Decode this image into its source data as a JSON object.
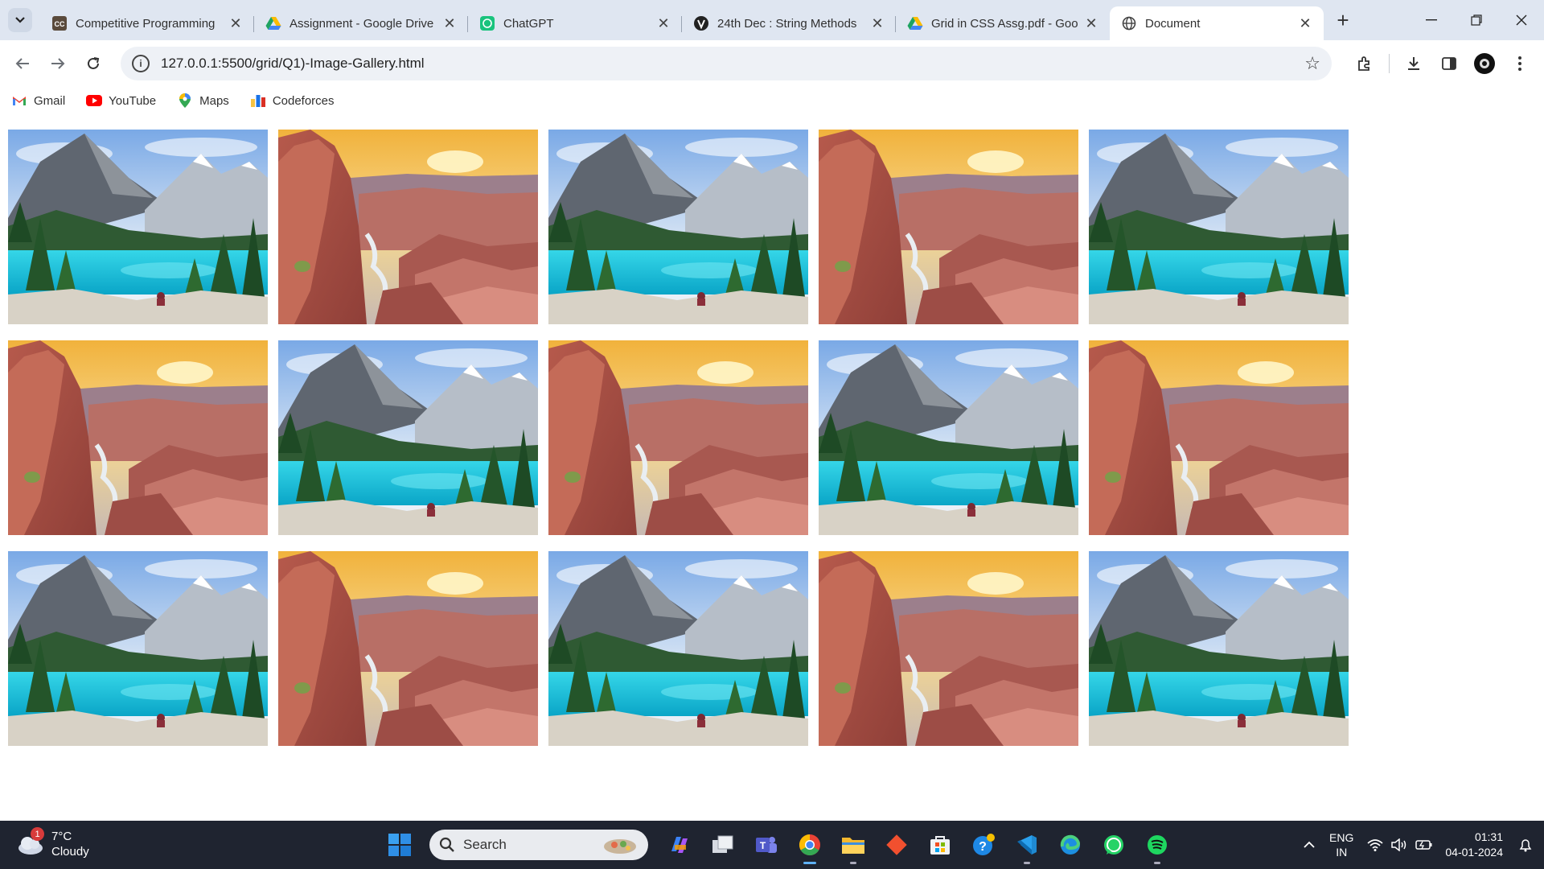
{
  "browser": {
    "tabs": [
      {
        "title": "Competitive Programming",
        "icon": "cc-icon"
      },
      {
        "title": "Assignment - Google Drive",
        "icon": "google-drive-icon"
      },
      {
        "title": "ChatGPT",
        "icon": "chatgpt-icon"
      },
      {
        "title": "24th Dec : String Methods",
        "icon": "site-icon"
      },
      {
        "title": "Grid in CSS Assg.pdf - Goo",
        "icon": "google-drive-icon"
      },
      {
        "title": "Document",
        "icon": "globe-icon",
        "active": true
      }
    ],
    "new_tab_symbol": "+",
    "address": "127.0.0.1:5500/grid/Q1)-Image-Gallery.html",
    "bookmarks": [
      {
        "label": "Gmail",
        "icon": "gmail-icon"
      },
      {
        "label": "YouTube",
        "icon": "youtube-icon"
      },
      {
        "label": "Maps",
        "icon": "maps-icon"
      },
      {
        "label": "Codeforces",
        "icon": "codeforces-icon"
      }
    ]
  },
  "gallery": {
    "rows": 3,
    "columns": 5,
    "images": [
      "lake",
      "canyon",
      "lake",
      "canyon",
      "lake",
      "canyon",
      "lake",
      "canyon",
      "lake",
      "canyon",
      "lake",
      "canyon",
      "lake",
      "canyon",
      "lake"
    ]
  },
  "taskbar": {
    "weather": {
      "temp": "7°C",
      "condition": "Cloudy",
      "badge": "1"
    },
    "search_label": "Search",
    "apps": [
      "copilot-icon",
      "task-view-icon",
      "teams-icon",
      "chrome-icon",
      "file-explorer-icon",
      "git-icon",
      "store-icon",
      "help-icon",
      "vscode-icon",
      "edge-icon",
      "whatsapp-icon",
      "spotify-icon"
    ],
    "lang": {
      "line1": "ENG",
      "line2": "IN"
    },
    "time": "01:31",
    "date": "04-01-2024"
  },
  "colors": {
    "tabstrip": "#dfe6f1",
    "taskbar": "#1f2430",
    "accent": "#5fb2f5"
  }
}
